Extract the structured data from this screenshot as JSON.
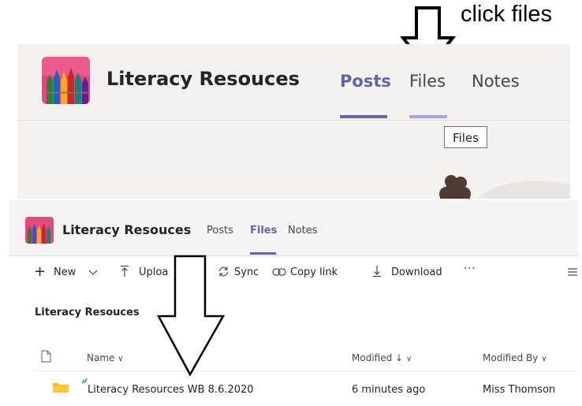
{
  "instruction": {
    "caption": "click files"
  },
  "top_view": {
    "team_name": "Literacy Resouces",
    "tabs": [
      {
        "label": "Posts"
      },
      {
        "label": "Files"
      },
      {
        "label": "Notes"
      }
    ],
    "tooltip": "Files"
  },
  "files_view": {
    "team_name": "Literacy Resouces",
    "tabs": [
      {
        "label": "Posts"
      },
      {
        "label": "Files"
      },
      {
        "label": "Notes"
      }
    ],
    "toolbar": {
      "new_label": "New",
      "upload_label": "Uploa",
      "sync_label": "Sync",
      "copy_link_label": "Copy link",
      "download_label": "Download",
      "more_label": "···"
    },
    "breadcrumb": "Literacy Resouces",
    "columns": {
      "name": "Name",
      "modified": "Modified",
      "modified_by": "Modified By"
    },
    "rows": [
      {
        "name": "Literacy Resources WB 8.6.2020",
        "modified": "6 minutes ago",
        "modified_by": "Miss Thomson"
      }
    ]
  },
  "colors": {
    "accent": "#6264a7",
    "header_bg": "#f3f2f1",
    "folder": "#ffb900"
  },
  "icons": [
    "arrow-down-icon",
    "team-pencils-icon",
    "plus-icon",
    "upload-icon",
    "sync-icon",
    "link-icon",
    "download-icon",
    "file-type-icon",
    "folder-icon",
    "chevron-down-icon",
    "sort-arrow-icon"
  ]
}
